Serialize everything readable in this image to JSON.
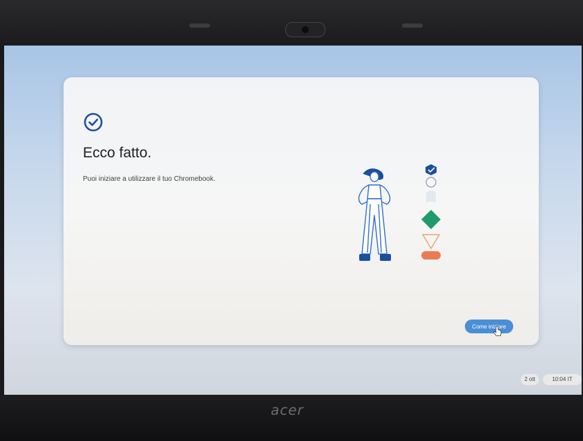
{
  "dialog": {
    "title": "Ecco fatto.",
    "subtitle": "Puoi iniziare a utilizzare il tuo Chromebook.",
    "primary_button": "Come iniziare"
  },
  "shelf": {
    "date": "2 ott",
    "time": "10:04 IT"
  },
  "bezel": {
    "brand": "acer"
  },
  "colors": {
    "accent": "#1a4fa0",
    "button": "#4a8fd6",
    "green": "#1e9a6d",
    "orange": "#ea7b52"
  },
  "icons": [
    "check-circle-icon",
    "pointer-cursor-icon"
  ]
}
